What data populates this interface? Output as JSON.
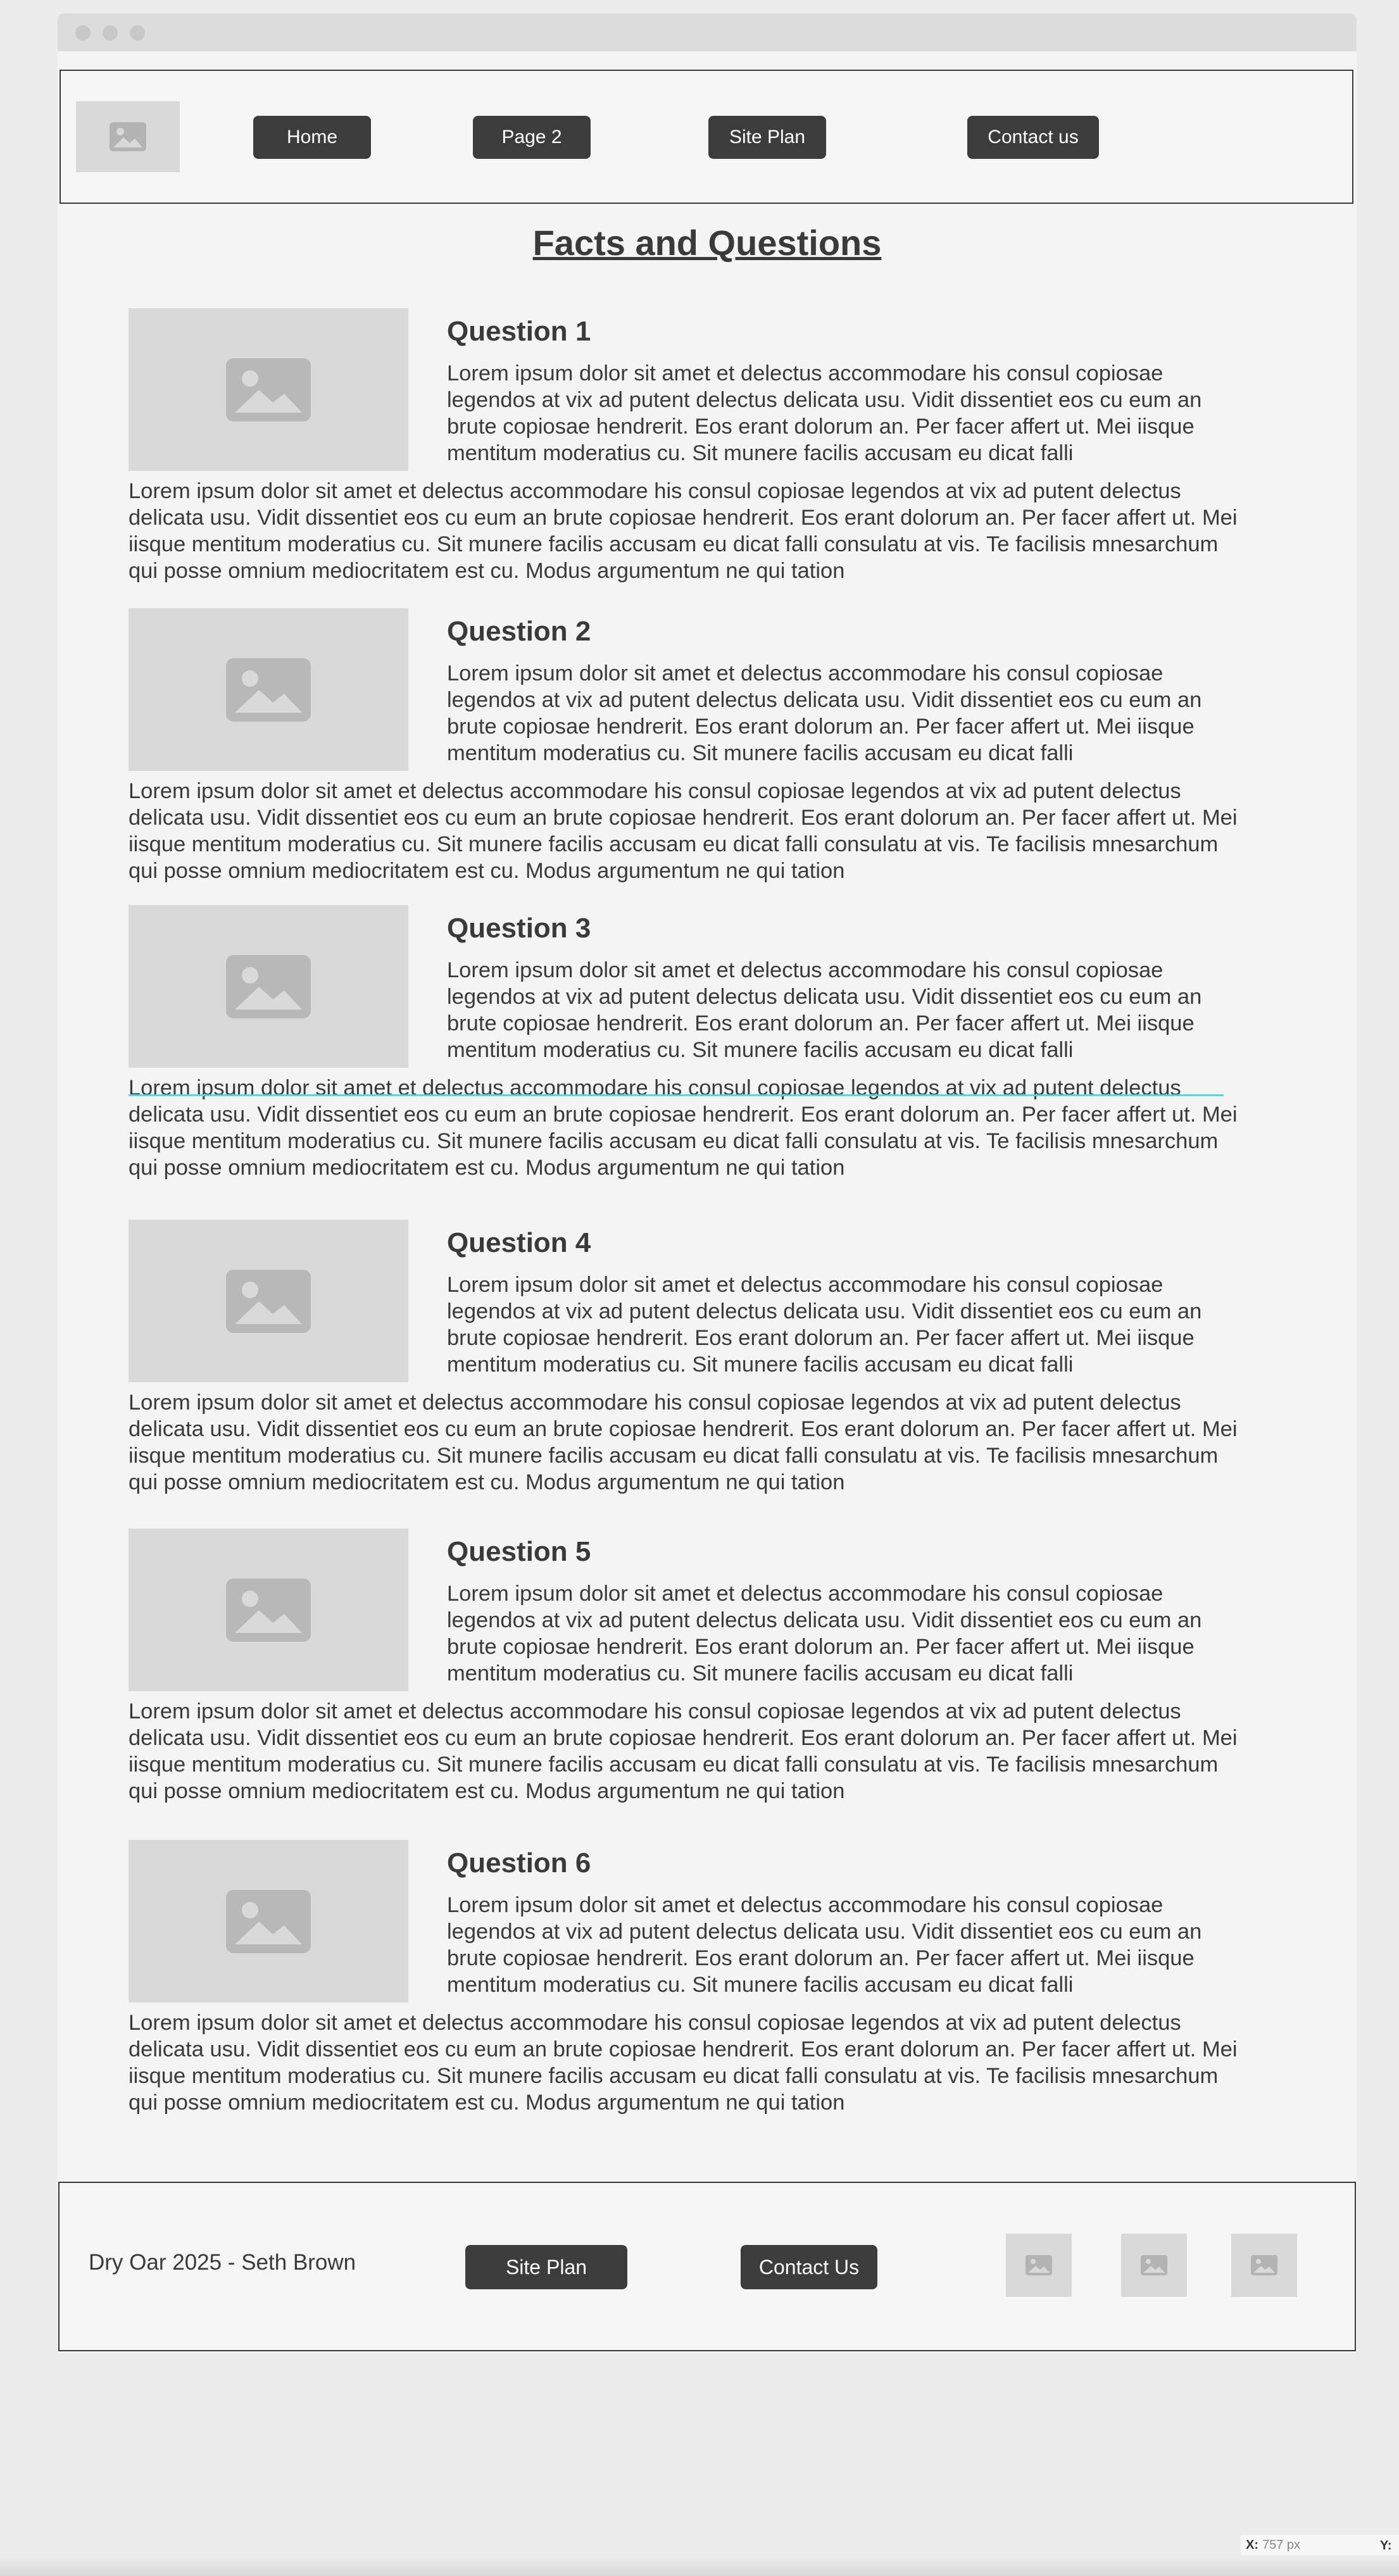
{
  "header": {
    "nav": [
      {
        "label": "Home"
      },
      {
        "label": "Page 2"
      },
      {
        "label": "Site Plan"
      },
      {
        "label": "Contact us"
      }
    ]
  },
  "page_title": "Facts and Questions",
  "sections": [
    {
      "title": "Question 1",
      "text": "Lorem ipsum dolor sit amet et delectus accommodare his consul copiosae legendos at vix ad putent delectus delicata usu. Vidit dissentiet eos cu eum an brute copiosae hendrerit. Eos erant dolorum an. Per facer affert ut. Mei iisque mentitum moderatius cu. Sit munere facilis accusam eu dicat falli",
      "full_text": "Lorem ipsum dolor sit amet et delectus accommodare his consul copiosae legendos at vix ad putent delectus delicata usu. Vidit dissentiet eos cu eum an brute copiosae hendrerit. Eos erant dolorum an. Per facer affert ut. Mei iisque mentitum moderatius cu. Sit munere facilis accusam eu dicat falli consulatu at vis. Te facilisis mnesarchum qui posse omnium mediocritatem est cu. Modus argumentum ne qui tation"
    },
    {
      "title": "Question 2",
      "text": "Lorem ipsum dolor sit amet et delectus accommodare his consul copiosae legendos at vix ad putent delectus delicata usu. Vidit dissentiet eos cu eum an brute copiosae hendrerit. Eos erant dolorum an. Per facer affert ut. Mei iisque mentitum moderatius cu. Sit munere facilis accusam eu dicat falli",
      "full_text": "Lorem ipsum dolor sit amet et delectus accommodare his consul copiosae legendos at vix ad putent delectus delicata usu. Vidit dissentiet eos cu eum an brute copiosae hendrerit. Eos erant dolorum an. Per facer affert ut. Mei iisque mentitum moderatius cu. Sit munere facilis accusam eu dicat falli consulatu at vis. Te facilisis mnesarchum qui posse omnium mediocritatem est cu. Modus argumentum ne qui tation"
    },
    {
      "title": "Question 3",
      "text": "Lorem ipsum dolor sit amet et delectus accommodare his consul copiosae legendos at vix ad putent delectus delicata usu. Vidit dissentiet eos cu eum an brute copiosae hendrerit. Eos erant dolorum an. Per facer affert ut. Mei iisque mentitum moderatius cu. Sit munere facilis accusam eu dicat falli",
      "full_text": "Lorem ipsum dolor sit amet et delectus accommodare his consul copiosae legendos at vix ad putent delectus delicata usu. Vidit dissentiet eos cu eum an brute copiosae hendrerit. Eos erant dolorum an. Per facer affert ut. Mei iisque mentitum moderatius cu. Sit munere facilis accusam eu dicat falli consulatu at vis. Te facilisis mnesarchum qui posse omnium mediocritatem est cu. Modus argumentum ne qui tation"
    },
    {
      "title": "Question 4",
      "text": "Lorem ipsum dolor sit amet et delectus accommodare his consul copiosae legendos at vix ad putent delectus delicata usu. Vidit dissentiet eos cu eum an brute copiosae hendrerit. Eos erant dolorum an. Per facer affert ut. Mei iisque mentitum moderatius cu. Sit munere facilis accusam eu dicat falli",
      "full_text": "Lorem ipsum dolor sit amet et delectus accommodare his consul copiosae legendos at vix ad putent delectus delicata usu. Vidit dissentiet eos cu eum an brute copiosae hendrerit. Eos erant dolorum an. Per facer affert ut. Mei iisque mentitum moderatius cu. Sit munere facilis accusam eu dicat falli consulatu at vis. Te facilisis mnesarchum qui posse omnium mediocritatem est cu. Modus argumentum ne qui tation"
    },
    {
      "title": "Question 5",
      "text": "Lorem ipsum dolor sit amet et delectus accommodare his consul copiosae legendos at vix ad putent delectus delicata usu. Vidit dissentiet eos cu eum an brute copiosae hendrerit. Eos erant dolorum an. Per facer affert ut. Mei iisque mentitum moderatius cu. Sit munere facilis accusam eu dicat falli",
      "full_text": "Lorem ipsum dolor sit amet et delectus accommodare his consul copiosae legendos at vix ad putent delectus delicata usu. Vidit dissentiet eos cu eum an brute copiosae hendrerit. Eos erant dolorum an. Per facer affert ut. Mei iisque mentitum moderatius cu. Sit munere facilis accusam eu dicat falli consulatu at vis. Te facilisis mnesarchum qui posse omnium mediocritatem est cu. Modus argumentum ne qui tation"
    },
    {
      "title": "Question 6",
      "text": "Lorem ipsum dolor sit amet et delectus accommodare his consul copiosae legendos at vix ad putent delectus delicata usu. Vidit dissentiet eos cu eum an brute copiosae hendrerit. Eos erant dolorum an. Per facer affert ut. Mei iisque mentitum moderatius cu. Sit munere facilis accusam eu dicat falli",
      "full_text": "Lorem ipsum dolor sit amet et delectus accommodare his consul copiosae legendos at vix ad putent delectus delicata usu. Vidit dissentiet eos cu eum an brute copiosae hendrerit. Eos erant dolorum an. Per facer affert ut. Mei iisque mentitum moderatius cu. Sit munere facilis accusam eu dicat falli consulatu at vis. Te facilisis mnesarchum qui posse omnium mediocritatem est cu. Modus argumentum ne qui tation"
    }
  ],
  "footer": {
    "credit": "Dry Oar 2025 - Seth Brown",
    "site_plan_label": "Site Plan",
    "contact_label": "Contact Us"
  },
  "status": {
    "x_label": "X:",
    "x_value": "757 px",
    "y_label": "Y:"
  },
  "icons": {
    "image_placeholder": "image-placeholder-icon"
  },
  "colors": {
    "button_bg": "#3c3c3c",
    "placeholder_bg": "#d9d9d9",
    "guide_line": "#4dd9e8"
  }
}
